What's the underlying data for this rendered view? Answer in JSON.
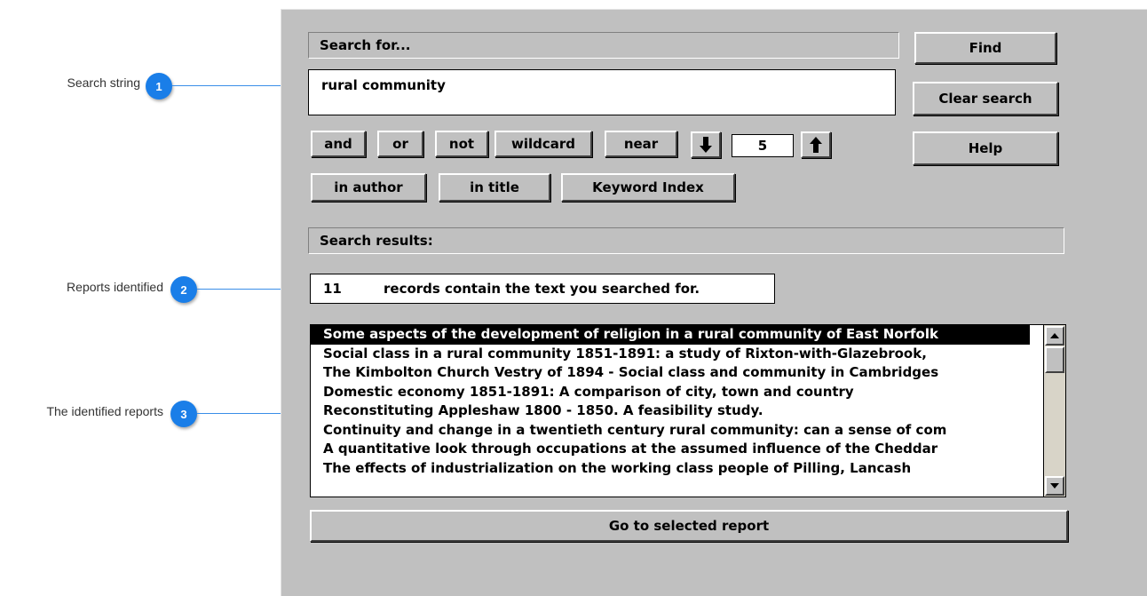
{
  "callouts": [
    {
      "number": "1",
      "label": "Search string"
    },
    {
      "number": "2",
      "label": "Reports identified"
    },
    {
      "number": "3",
      "label": "The identified reports"
    }
  ],
  "search": {
    "header": "Search for...",
    "value": "rural community"
  },
  "buttons": {
    "find": "Find",
    "clear": "Clear search",
    "help": "Help",
    "and": "and",
    "or": "or",
    "not": "not",
    "wildcard": "wildcard",
    "near": "near",
    "in_author": "in author",
    "in_title": "in title",
    "keyword_index": "Keyword Index",
    "go": "Go to selected report"
  },
  "near_value": "5",
  "results": {
    "header": "Search results:",
    "count": "11",
    "count_text": "records contain the text you searched for.",
    "items": [
      "Some aspects of the development of religion in a rural community of East Norfolk",
      "Social class in a rural community 1851-1891: a study of Rixton-with-Glazebrook,",
      "The Kimbolton Church Vestry of 1894 - Social class and community in Cambridges",
      "Domestic economy 1851-1891: A comparison of city, town and country",
      "Reconstituting Appleshaw 1800 - 1850. A feasibility study.",
      "Continuity and change in a twentieth century rural community: can a sense of com",
      "A quantitative look through occupations at the assumed influence of the Cheddar",
      "The effects of industrialization on the working class people of Pilling, Lancash"
    ]
  }
}
